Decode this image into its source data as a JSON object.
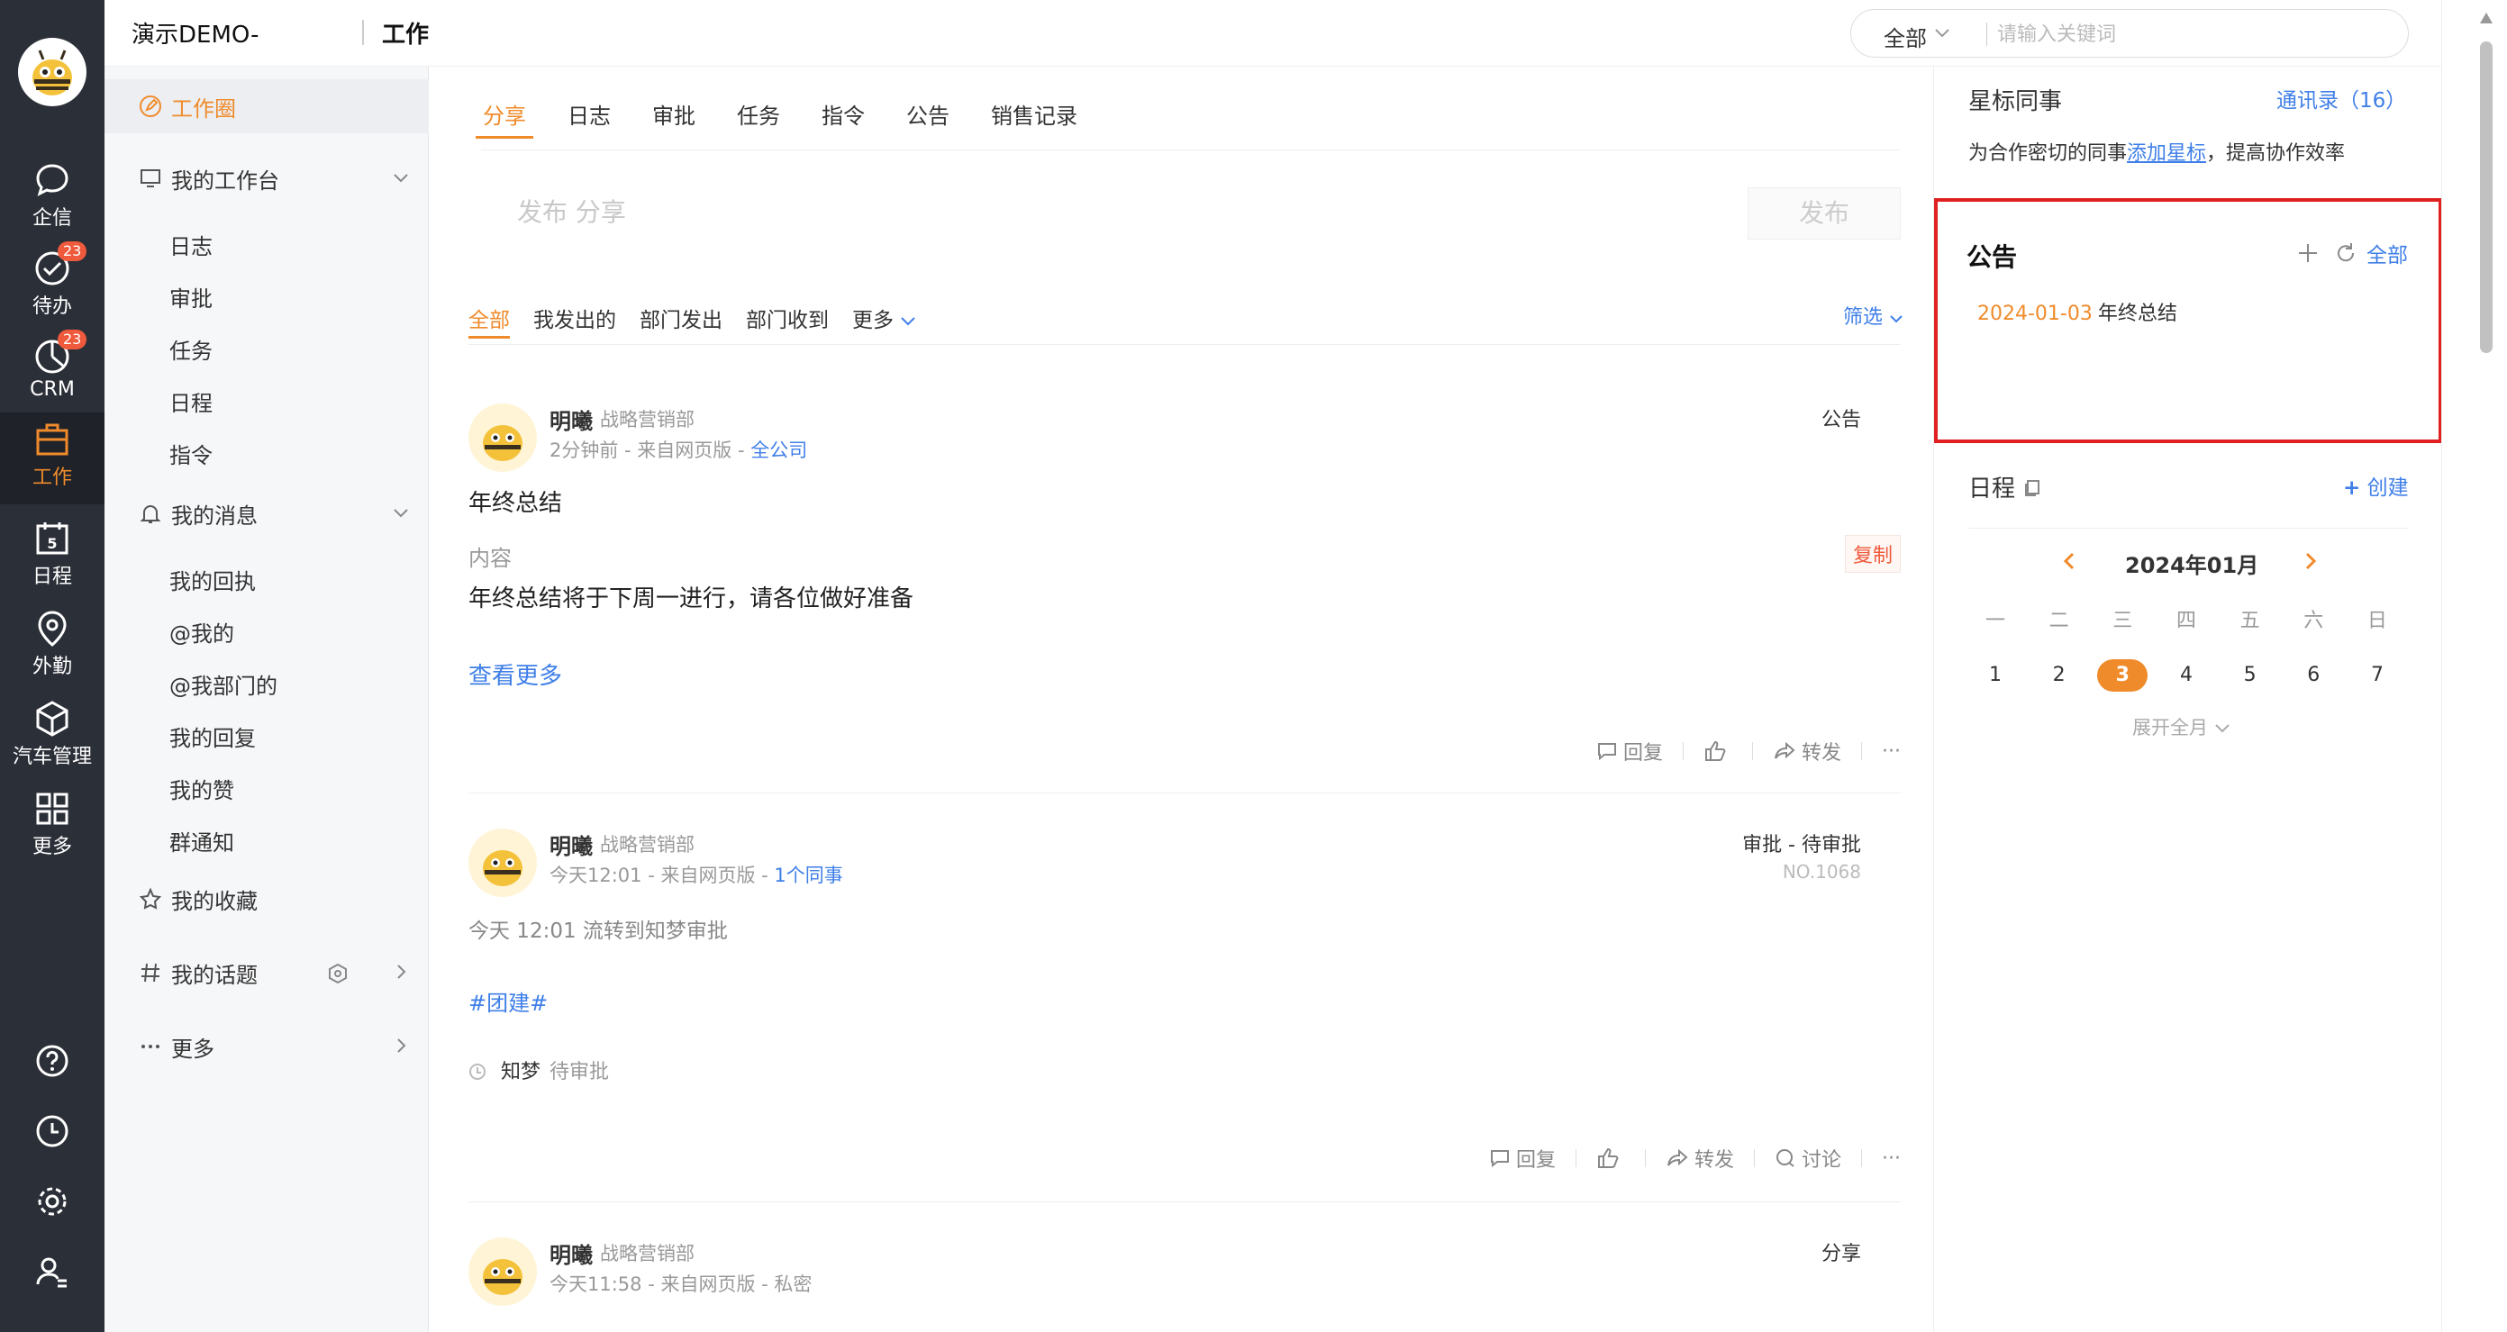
{
  "rail": {
    "items": [
      {
        "label": "企信",
        "badge": ""
      },
      {
        "label": "待办",
        "badge": "23"
      },
      {
        "label": "CRM",
        "badge": "23"
      },
      {
        "label": "工作",
        "badge": ""
      },
      {
        "label": "日程",
        "badge": ""
      },
      {
        "label": "外勤",
        "badge": ""
      },
      {
        "label": "汽车管理",
        "badge": ""
      },
      {
        "label": "更多",
        "badge": ""
      }
    ],
    "calendar_day": "5"
  },
  "header": {
    "company": "演示DEMO-",
    "title": "工作",
    "search_scope": "全部",
    "search_placeholder": "请输入关键词"
  },
  "subnav": {
    "work_circle": "工作圈",
    "my_workbench": "我的工作台",
    "workbench_items": [
      "日志",
      "审批",
      "任务",
      "日程",
      "指令"
    ],
    "my_messages": "我的消息",
    "message_items": [
      "我的回执",
      "@我的",
      "@我部门的",
      "我的回复",
      "我的赞",
      "群通知"
    ],
    "favorites": "我的收藏",
    "topics": "我的话题",
    "more": "更多"
  },
  "feed": {
    "tabs": [
      "分享",
      "日志",
      "审批",
      "任务",
      "指令",
      "公告",
      "销售记录"
    ],
    "compose_placeholder": "发布 分享",
    "publish_label": "发布",
    "filters": [
      "全部",
      "我发出的",
      "部门发出",
      "部门收到",
      "更多"
    ],
    "filter_button": "筛选",
    "posts": [
      {
        "name": "明曦",
        "dept": "战略营销部",
        "meta": "2分钟前 - 来自网页版 - ",
        "meta_link": "全公司",
        "type": "公告",
        "title": "年终总结",
        "label": "内容",
        "copy": "复制",
        "body": "年终总结将于下周一进行，请各位做好准备",
        "more": "查看更多",
        "actions": {
          "reply": "回复",
          "forward": "转发",
          "more": "···"
        }
      },
      {
        "name": "明曦",
        "dept": "战略营销部",
        "meta": "今天12:01 - 来自网页版 - ",
        "meta_link": "1个同事",
        "type": "审批 - 待审批",
        "number": "NO.1068",
        "flow": "今天 12:01 流转到知梦审批",
        "tag": "#团建#",
        "approver": "知梦",
        "approver_state": "待审批",
        "actions": {
          "reply": "回复",
          "forward": "转发",
          "discuss": "讨论",
          "more": "···"
        }
      },
      {
        "name": "明曦",
        "dept": "战略营销部",
        "meta": "今天11:58 - 来自网页版 - 私密",
        "type": "分享"
      }
    ]
  },
  "right": {
    "star_title": "星标同事",
    "contacts_link": "通讯录（16）",
    "star_desc_pre": "为合作密切的同事",
    "star_desc_link": "添加星标",
    "star_desc_post": "，提高协作效率",
    "announce_title": "公告",
    "announce_all": "全部",
    "announce_item_date": "2024-01-03",
    "announce_item_title": "年终总结",
    "schedule_title": "日程",
    "create_label": "创建",
    "month": "2024年01月",
    "weekdays": [
      "一",
      "二",
      "三",
      "四",
      "五",
      "六",
      "日"
    ],
    "days": [
      "1",
      "2",
      "3",
      "4",
      "5",
      "6",
      "7"
    ],
    "today": "3",
    "expand_label": "展开全月"
  },
  "colors": {
    "accent": "#f08b2c",
    "link": "#3f7fe8",
    "rail": "#2b2f38",
    "highlight_box": "#e02020"
  }
}
